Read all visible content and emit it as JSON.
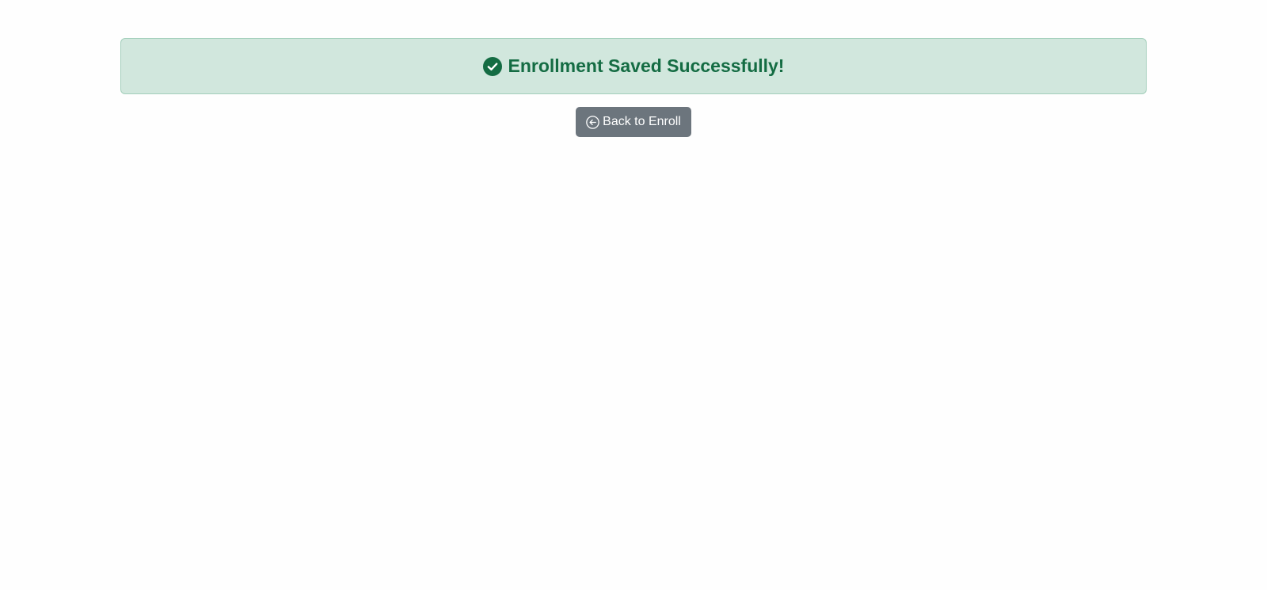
{
  "alert": {
    "message": "Enrollment Saved Successfully!",
    "icon": "check-circle-icon",
    "text_color": "#146c43",
    "background": "#d1e7dd",
    "border": "#a3cfbb"
  },
  "actions": {
    "back_label": "Back to Enroll",
    "back_icon": "arrow-left-circle-icon",
    "button_color": "#6c757d"
  }
}
